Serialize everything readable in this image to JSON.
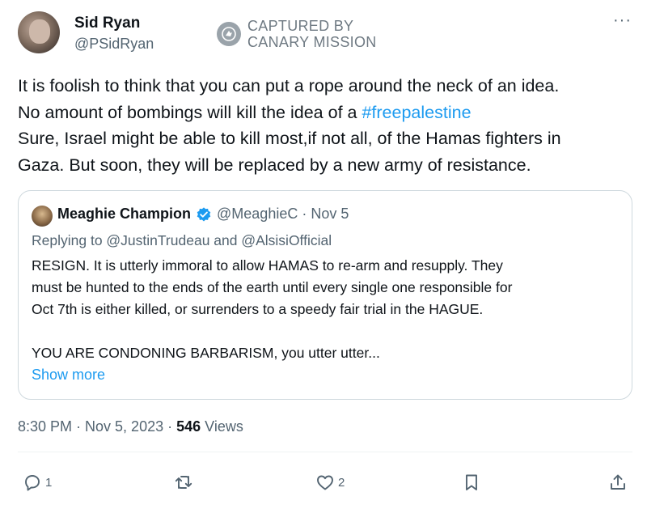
{
  "tweet": {
    "author_name": "Sid Ryan",
    "author_handle": "@PSidRyan",
    "more_label": "···",
    "watermark": {
      "line1": "CAPTURED BY",
      "line2": "CANARY MISSION"
    },
    "text": {
      "line1": "It is foolish to think that you can put a rope around the neck of an idea.",
      "line2_prefix": "No amount of bombings will kill the idea of a ",
      "hashtag": "#freepalestine",
      "line3": "Sure, Israel might be able to kill most,if not all, of the Hamas fighters in",
      "line4": "Gaza. But soon, they will be replaced by a new army of resistance."
    },
    "timestamp": "8:30 PM · Nov 5, 2023 · ",
    "views_count": "546",
    "views_label": " Views"
  },
  "quoted": {
    "author_name": "Meaghie Champion",
    "handle_and_date": "@MeaghieC · Nov 5",
    "replying_to": "Replying to @JustinTrudeau and @AlsisiOfficial",
    "body": {
      "line1": "RESIGN. It is utterly immoral to allow HAMAS to re-arm and resupply. They",
      "line2": "must be hunted to the ends of the earth until every single one responsible for",
      "line3": "Oct 7th is either killed, or surrenders to a speedy fair trial in the HAGUE.",
      "line4": "YOU ARE CONDONING BARBARISM, you utter utter..."
    },
    "show_more": "Show more"
  },
  "actions": {
    "reply_count": "1",
    "retweet_count": "",
    "like_count": "2"
  },
  "colors": {
    "link": "#1d9bf0",
    "muted": "#536471",
    "text": "#0f1419",
    "verified": "#1d9bf0"
  },
  "icons": [
    "reply-icon",
    "retweet-icon",
    "like-icon",
    "bookmark-icon",
    "share-icon",
    "verified-badge-icon",
    "more-icon",
    "canary-logo-icon"
  ]
}
